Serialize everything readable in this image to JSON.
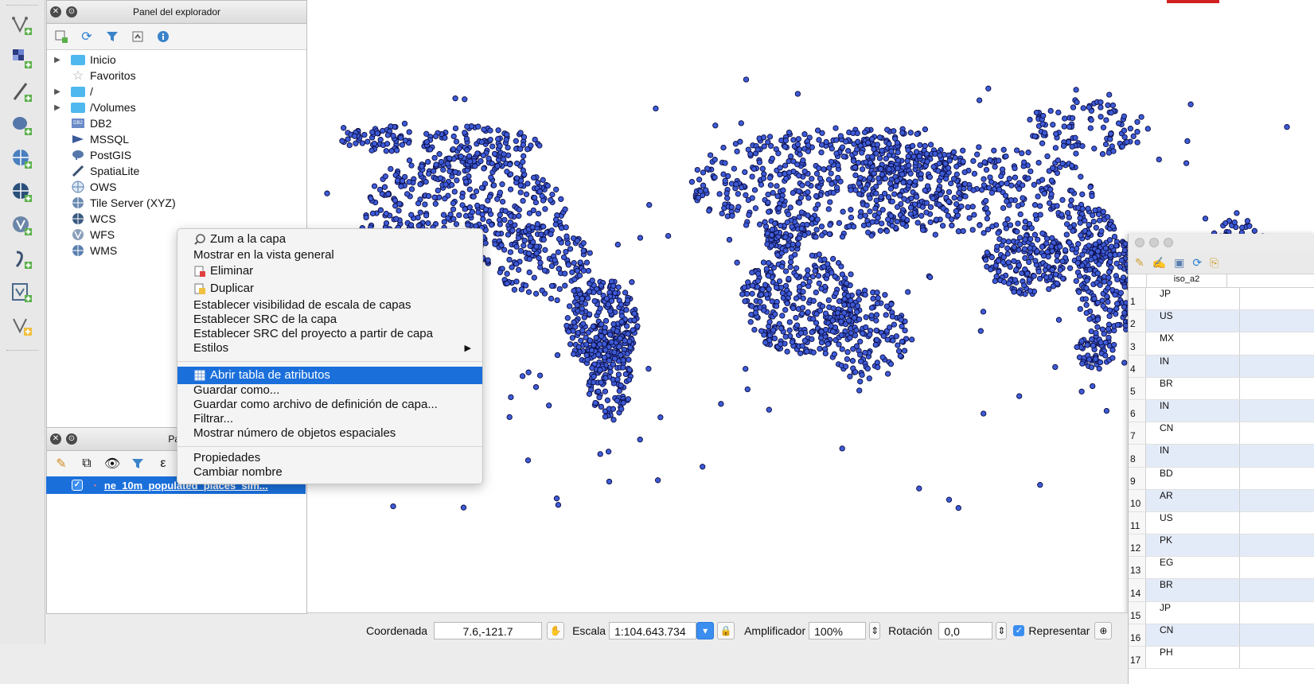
{
  "browser_panel": {
    "title": "Panel del explorador",
    "items": [
      {
        "label": "Inicio",
        "icon": "folder-icon",
        "expandable": true
      },
      {
        "label": "Favoritos",
        "icon": "star-icon",
        "expandable": false
      },
      {
        "label": "/",
        "icon": "folder-icon",
        "expandable": true
      },
      {
        "label": "/Volumes",
        "icon": "folder-icon",
        "expandable": true
      },
      {
        "label": "DB2",
        "icon": "db2-icon",
        "expandable": false
      },
      {
        "label": "MSSQL",
        "icon": "mssql-icon",
        "expandable": false
      },
      {
        "label": "PostGIS",
        "icon": "elephant-icon",
        "expandable": false
      },
      {
        "label": "SpatiaLite",
        "icon": "feather-icon",
        "expandable": false
      },
      {
        "label": "OWS",
        "icon": "globe-icon",
        "expandable": false
      },
      {
        "label": "Tile Server (XYZ)",
        "icon": "globe-icon",
        "expandable": false
      },
      {
        "label": "WCS",
        "icon": "globe-icon",
        "expandable": false
      },
      {
        "label": "WFS",
        "icon": "globe-icon",
        "expandable": false
      },
      {
        "label": "WMS",
        "icon": "globe-icon",
        "expandable": false
      }
    ]
  },
  "layers_panel": {
    "title": "Pan",
    "layer_name": "ne_10m_populated_places_sim...",
    "layer_visible": true
  },
  "context_menu": {
    "items": [
      {
        "label": "Zum a la capa",
        "icon": "zoom-icon"
      },
      {
        "label": "Mostrar en la vista general"
      },
      {
        "label": "Eliminar",
        "icon": "remove-layer-icon"
      },
      {
        "label": "Duplicar",
        "icon": "duplicate-icon"
      },
      {
        "label": "Establecer visibilidad de escala de capas"
      },
      {
        "label": "Establecer SRC de la capa"
      },
      {
        "label": "Establecer SRC del proyecto a partir de capa"
      },
      {
        "label": "Estilos",
        "submenu": true
      },
      {
        "label": "Abrir tabla de atributos",
        "icon": "table-icon",
        "selected": true
      },
      {
        "label": "Guardar como..."
      },
      {
        "label": "Guardar como archivo de definición de capa..."
      },
      {
        "label": "Filtrar..."
      },
      {
        "label": "Mostrar número de objetos espaciales"
      },
      {
        "label": "Propiedades"
      },
      {
        "label": "Cambiar nombre"
      }
    ]
  },
  "attribute_table": {
    "column": "iso_a2",
    "rows": [
      {
        "n": "1",
        "v": "JP"
      },
      {
        "n": "2",
        "v": "US"
      },
      {
        "n": "3",
        "v": "MX"
      },
      {
        "n": "4",
        "v": "IN"
      },
      {
        "n": "5",
        "v": "BR"
      },
      {
        "n": "6",
        "v": "IN"
      },
      {
        "n": "7",
        "v": "CN"
      },
      {
        "n": "8",
        "v": "IN"
      },
      {
        "n": "9",
        "v": "BD"
      },
      {
        "n": "10",
        "v": "AR"
      },
      {
        "n": "11",
        "v": "US"
      },
      {
        "n": "12",
        "v": "PK"
      },
      {
        "n": "13",
        "v": "EG"
      },
      {
        "n": "14",
        "v": "BR"
      },
      {
        "n": "15",
        "v": "JP"
      },
      {
        "n": "16",
        "v": "CN"
      },
      {
        "n": "17",
        "v": "PH"
      }
    ]
  },
  "status_bar": {
    "coord_label": "Coordenada",
    "coord_value": "7.6,-121.7",
    "scale_label": "Escala",
    "scale_value": "1:104.643.734",
    "magnifier_label": "Amplificador",
    "magnifier_value": "100%",
    "rotation_label": "Rotación",
    "rotation_value": "0,0",
    "render_label": "Representar",
    "render_checked": true
  },
  "colors": {
    "point_fill": "#3d5bd6",
    "point_stroke": "#0a0a40",
    "selection": "#1a6fdb"
  }
}
